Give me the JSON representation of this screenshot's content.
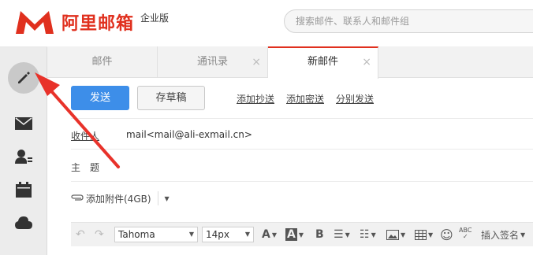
{
  "brand": {
    "title": "阿里邮箱",
    "subtitle": "企业版",
    "color": "#e0301e"
  },
  "search": {
    "placeholder": "搜索邮件、联系人和邮件组"
  },
  "sidebar": {
    "items": [
      {
        "icon": "pencil-icon"
      },
      {
        "icon": "envelope-icon"
      },
      {
        "icon": "contact-icon"
      },
      {
        "icon": "calendar-icon"
      },
      {
        "icon": "cloud-icon"
      }
    ]
  },
  "tabs": [
    {
      "label": "邮件",
      "closable": false
    },
    {
      "label": "通讯录",
      "closable": true,
      "close": "×"
    },
    {
      "label": "新邮件",
      "closable": true,
      "close": "×",
      "active": true
    }
  ],
  "toolbar": {
    "send_label": "发送",
    "draft_label": "存草稿",
    "cc_label": "添加抄送",
    "bcc_label": "添加密送",
    "separate_label": "分别发送",
    "send_color": "#3d8ee9"
  },
  "compose": {
    "to_label": "收件人",
    "to_value": "mail<mail@ali-exmail.cn>",
    "subject_label": "主　题",
    "subject_value": "",
    "attach_label": "添加附件(4GB)"
  },
  "editor": {
    "font": "Tahoma",
    "size": "14px",
    "signature_label": "插入签名",
    "spell_label": "ABC"
  }
}
